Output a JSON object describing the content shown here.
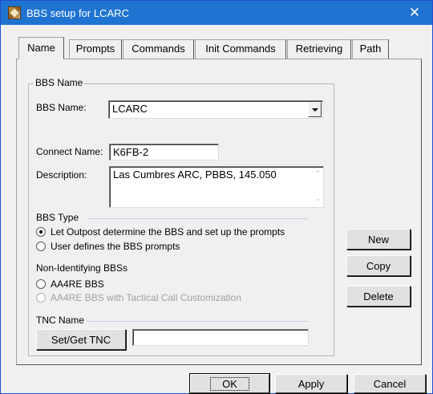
{
  "window": {
    "title": "BBS setup for LCARC",
    "close_icon": "✕",
    "title_color": "#1f74d1"
  },
  "tabs": [
    {
      "label": "Name",
      "active": true
    },
    {
      "label": "Prompts"
    },
    {
      "label": "Commands"
    },
    {
      "label": "Init Commands"
    },
    {
      "label": "Retrieving"
    },
    {
      "label": "Path"
    }
  ],
  "bbs_name": {
    "group_label": "BBS Name",
    "name_label": "BBS Name:",
    "name_value": "LCARC",
    "connect_label": "Connect Name:",
    "connect_value": "K6FB-2",
    "description_label": "Description:",
    "description_value": "Las Cumbres ARC, PBBS, 145.050",
    "scroll_up": "⌃",
    "scroll_down": "⌄"
  },
  "bbs_type": {
    "label": "BBS Type",
    "options": [
      {
        "label": "Let Outpost determine the BBS and set up the prompts",
        "checked": true
      },
      {
        "label": "User defines the BBS prompts",
        "checked": false
      }
    ]
  },
  "non_identifying": {
    "label": "Non-Identifying BBSs",
    "options": [
      {
        "label": "AA4RE BBS",
        "checked": false,
        "disabled": false
      },
      {
        "label": "AA4RE BBS with Tactical Call Customization",
        "checked": false,
        "disabled": true
      }
    ]
  },
  "tnc": {
    "label": "TNC Name",
    "button": "Set/Get TNC",
    "value": ""
  },
  "side_buttons": {
    "new": "New",
    "copy": "Copy",
    "delete": "Delete"
  },
  "footer": {
    "ok": "OK",
    "apply": "Apply",
    "cancel": "Cancel"
  }
}
